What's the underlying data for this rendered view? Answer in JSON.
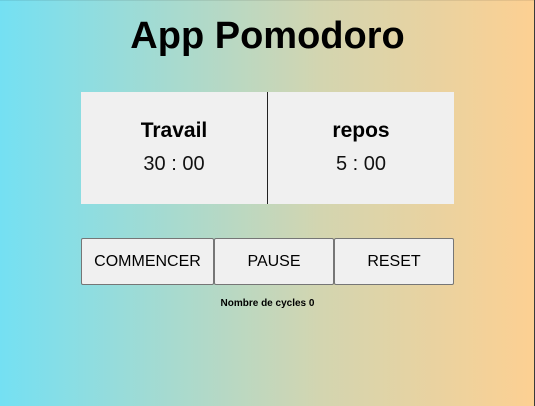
{
  "app": {
    "title": "App Pomodoro"
  },
  "timers": {
    "work": {
      "label": "Travail",
      "value": "30 : 00"
    },
    "rest": {
      "label": "repos",
      "value": "5 : 00"
    }
  },
  "controls": {
    "start_label": "COMMENCER",
    "pause_label": "PAUSE",
    "reset_label": "RESET"
  },
  "cycles": {
    "label": "Nombre de cycles",
    "count": "0"
  },
  "colors": {
    "gradient_start": "#74e0f3",
    "gradient_end": "#fdd092",
    "panel_background": "#f0f0f0"
  }
}
